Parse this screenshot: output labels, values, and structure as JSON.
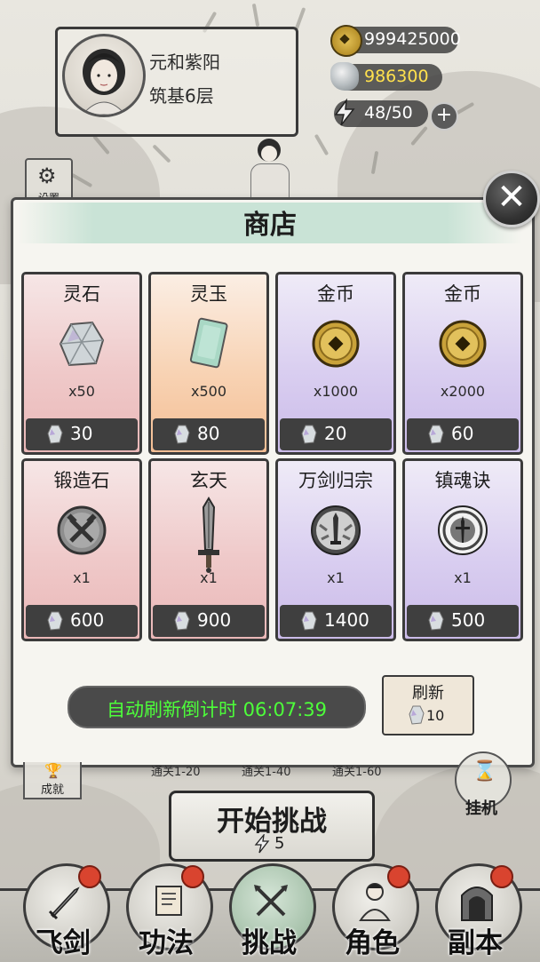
{
  "player": {
    "name": "元和紫阳",
    "rank": "筑基6层"
  },
  "resources": {
    "coins": "999425000",
    "spirit_stone": "986300",
    "stamina": "48/50"
  },
  "side_buttons": {
    "settings_label": "设置",
    "achievements_label": "成就",
    "idle_label": "挂机"
  },
  "shop": {
    "title": "商店",
    "items": [
      {
        "name": "灵石",
        "qty": "x50",
        "price": "30",
        "rarity": "pink",
        "icon": "spirit-stone-icon"
      },
      {
        "name": "灵玉",
        "qty": "x500",
        "price": "80",
        "rarity": "orange",
        "icon": "spirit-jade-icon"
      },
      {
        "name": "金币",
        "qty": "x1000",
        "price": "20",
        "rarity": "purple",
        "icon": "gold-coin-icon"
      },
      {
        "name": "金币",
        "qty": "x2000",
        "price": "60",
        "rarity": "purple",
        "icon": "gold-coin-icon"
      },
      {
        "name": "锻造石",
        "qty": "x1",
        "price": "600",
        "rarity": "pink",
        "icon": "forge-stone-icon"
      },
      {
        "name": "玄天",
        "qty": "x1",
        "price": "900",
        "rarity": "pink",
        "icon": "sword-icon"
      },
      {
        "name": "万剑归宗",
        "qty": "x1",
        "price": "1400",
        "rarity": "purple",
        "icon": "sword-skill-icon"
      },
      {
        "name": "镇魂诀",
        "qty": "x1",
        "price": "500",
        "rarity": "purple",
        "icon": "soul-skill-icon"
      }
    ],
    "timer_label": "自动刷新倒计时 06:07:39",
    "refresh_label": "刷新",
    "refresh_cost": "10"
  },
  "stages": [
    "通关1-20",
    "通关1-40",
    "通关1-60"
  ],
  "challenge": {
    "label": "开始挑战",
    "cost": "5"
  },
  "bottom_nav": [
    {
      "label": "飞剑",
      "badge": true,
      "icon": "flying-sword-icon"
    },
    {
      "label": "功法",
      "badge": true,
      "icon": "scroll-icon"
    },
    {
      "label": "挑战",
      "badge": false,
      "icon": "crossed-swords-icon"
    },
    {
      "label": "角色",
      "badge": true,
      "icon": "character-icon"
    },
    {
      "label": "副本",
      "badge": true,
      "icon": "dungeon-gate-icon"
    }
  ],
  "colors": {
    "timer_text": "#4dff3a",
    "coin_value": "#ffffff",
    "stone_value": "#ffe14d",
    "badge": "#d9442f"
  }
}
